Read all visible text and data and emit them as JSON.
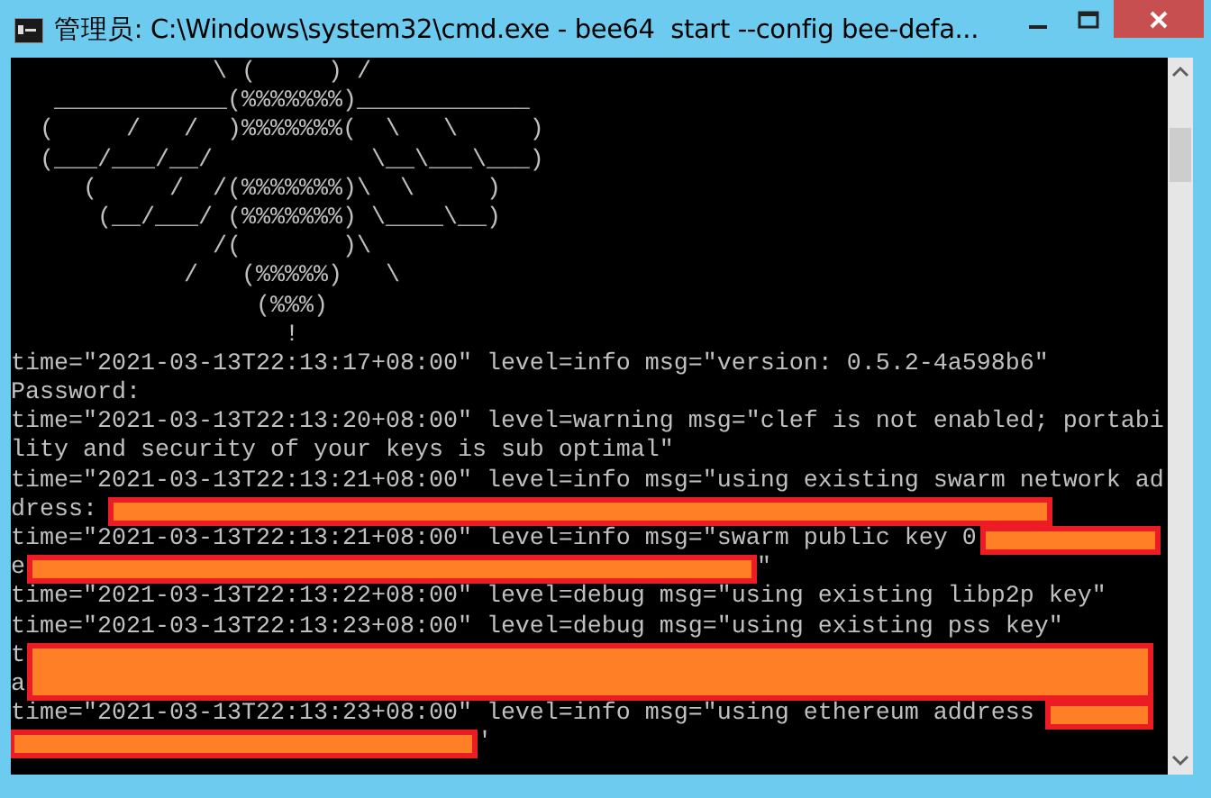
{
  "window": {
    "title": "管理员: C:\\Windows\\system32\\cmd.exe - bee64  start --config bee-defa..."
  },
  "console": {
    "art_lines": [
      "              \\ (     ) /",
      "   ____________(%%%%%%%)____________",
      "  (     /   /  )%%%%%%%(  \\   \\     )",
      "  (___/___/__/           \\__\\___\\___)",
      "     (     /  /(%%%%%%%)\\  \\     )",
      "      (__/___/ (%%%%%%%) \\____\\__)",
      "              /(       )\\",
      "            /   (%%%%%)   \\",
      "                 (%%%)",
      "                   !"
    ],
    "log_lines": [
      {
        "text": "time=\"2021-03-13T22:13:17+08:00\" level=info msg=\"version: 0.5.2-4a598b6\""
      },
      {
        "text": "Password:"
      },
      {
        "text": "time=\"2021-03-13T22:13:20+08:00\" level=warning msg=\"clef is not enabled; portabi"
      },
      {
        "text": "lity and security of your keys is sub optimal\""
      },
      {
        "text": "time=\"2021-03-13T22:13:21+08:00\" level=info msg=\"using existing swarm network ad"
      },
      {
        "parts": [
          {
            "kind": "text",
            "text": "dress:"
          },
          {
            "kind": "redacted"
          }
        ]
      },
      {
        "parts": [
          {
            "kind": "text",
            "text": "time=\"2021-03-13T22:13:21+08:00\" level=info msg=\"swarm public key 0"
          },
          {
            "kind": "redacted"
          }
        ]
      },
      {
        "parts": [
          {
            "kind": "text",
            "text": "e"
          },
          {
            "kind": "redacted"
          },
          {
            "kind": "text",
            "text": "\""
          }
        ]
      },
      {
        "text": "time=\"2021-03-13T22:13:22+08:00\" level=debug msg=\"using existing libp2p key\""
      },
      {
        "text": "time=\"2021-03-13T22:13:23+08:00\" level=debug msg=\"using existing pss key\""
      },
      {
        "parts": [
          {
            "kind": "text",
            "text": "t"
          },
          {
            "kind": "redacted"
          }
        ]
      },
      {
        "text": "a"
      },
      {
        "parts": [
          {
            "kind": "text",
            "text": "time=\"2021-03-13T22:13:23+08:00\" level=info msg=\"using ethereum address"
          },
          {
            "kind": "redacted"
          }
        ]
      },
      {
        "parts": [
          {
            "kind": "redacted"
          },
          {
            "kind": "text",
            "text": "'"
          }
        ]
      }
    ]
  }
}
